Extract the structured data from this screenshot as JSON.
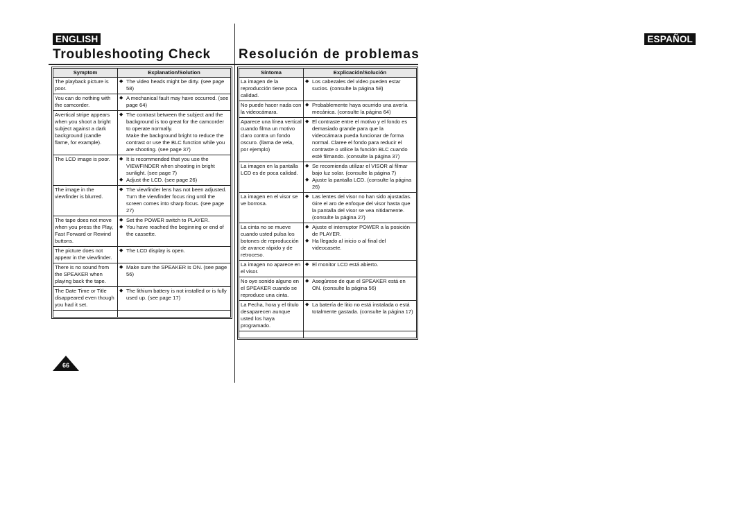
{
  "english": {
    "badge": "ENGLISH",
    "title": "Troubleshooting Check",
    "headers": {
      "symptom": "Symptom",
      "solution": "Explanation/Solution"
    },
    "rows": [
      {
        "symptom": "The playback picture is poor.",
        "solutions": [
          {
            "bullet": true,
            "text": "The video heads might be dirty. (see page 58)"
          }
        ]
      },
      {
        "symptom": "You can do nothing with the camcorder.",
        "solutions": [
          {
            "bullet": true,
            "text": "A mechanical fault may have occurred. (see page 64)"
          }
        ]
      },
      {
        "symptom": "Avertical stripe appears when you shoot a bright subject against a dark background (candle flame, for example).",
        "solutions": [
          {
            "bullet": true,
            "text": "The contrast between the subject and the background is too great for the camcorder to operate normally."
          },
          {
            "bullet": false,
            "text": "Make the background bright to reduce the contrast or use the BLC function while you are shooting. (see page 37)"
          }
        ]
      },
      {
        "symptom": "The LCD image is poor.",
        "solutions": [
          {
            "bullet": true,
            "text": "It is recommended that you use the VIEWFINDER when shooting in bright sunlight. (see page 7)"
          },
          {
            "bullet": true,
            "text": "Adjust the LCD. (see page 26)"
          }
        ]
      },
      {
        "symptom": "The image in the viewfinder is blurred.",
        "solutions": [
          {
            "bullet": true,
            "text": "The viewfinder lens has not been adjusted. Turn the viewfinder focus ring until the screen comes into sharp focus. (see page 27)"
          }
        ]
      },
      {
        "symptom": "The tape does not move when you press the Play, Fast Forward or Rewind buttons.",
        "solutions": [
          {
            "bullet": true,
            "text": "Set the POWER switch to PLAYER."
          },
          {
            "bullet": true,
            "text": "You have reached the beginning or end of the cassette."
          }
        ]
      },
      {
        "symptom": "The picture does not appear in the viewfinder.",
        "solutions": [
          {
            "bullet": true,
            "text": "The LCD display is open."
          }
        ]
      },
      {
        "symptom": "There is no sound from the SPEAKER when playing back the tape.",
        "solutions": [
          {
            "bullet": true,
            "text": "Make sure the SPEAKER is ON. (see page 56)"
          }
        ]
      },
      {
        "symptom": "The Date Time or Title disappeared even though you had it set.",
        "solutions": [
          {
            "bullet": true,
            "text": "The lithium battery is not installed or is fully used up. (see page 17)"
          }
        ]
      }
    ]
  },
  "spanish": {
    "badge": "ESPAÑOL",
    "title": "Resolución de problemas",
    "headers": {
      "symptom": "Síntoma",
      "solution": "Explicación/Solución"
    },
    "rows": [
      {
        "symptom": "La imagen de la reproducción tiene poca calidad.",
        "solutions": [
          {
            "bullet": true,
            "text": "Los cabezales del video pueden estar sucios. (consulte la página 58)"
          }
        ]
      },
      {
        "symptom": "No puede hacer nada con la videocámara.",
        "solutions": [
          {
            "bullet": true,
            "text": "Probablemente haya ocurrido una avería mecánica. (consulte la página 64)"
          }
        ]
      },
      {
        "symptom": "Aparece una línea vertical cuando filma un motivo claro contra un fondo oscuro. (llama de vela, por ejemplo)",
        "solutions": [
          {
            "bullet": true,
            "text": "El contraste entre el motivo y el fondo es demasiado grande para que la videocámara pueda funcionar de forma normal. Claree el fondo para reducir el contraste o utilice la función BLC cuando esté filmando. (consulte la página 37)"
          }
        ]
      },
      {
        "symptom": "La imagen en la pantalla LCD es de poca calidad.",
        "solutions": [
          {
            "bullet": true,
            "text": "Se recomienda utilizar el VISOR al filmar bajo luz solar. (consulte la página 7)"
          },
          {
            "bullet": true,
            "text": "Ajuste la pantalla LCD. (consulte la página 26)"
          }
        ]
      },
      {
        "symptom": "La imagen en el visor se ve borrosa.",
        "solutions": [
          {
            "bullet": true,
            "text": "Las lentes del visor no han sido ajustadas. Gire el aro de enfoque del visor hasta que la pantalla del visor se vea nitidamente. (consulte la página 27)"
          }
        ]
      },
      {
        "symptom": "La cinta no se mueve cuando usted pulsa los botones de reproducción de avance rápido y de retroceso.",
        "solutions": [
          {
            "bullet": true,
            "text": "Ajuste el interruptor POWER a la posición de PLAYER."
          },
          {
            "bullet": true,
            "text": "Ha llegado al inicio o al final del videocasete."
          }
        ]
      },
      {
        "symptom": "La imagen no aparece en el visor.",
        "solutions": [
          {
            "bullet": true,
            "text": "El monitor LCD está abierto."
          }
        ]
      },
      {
        "symptom": "No oye sonido alguno en el SPEAKER cuando se reproduce una cinta.",
        "solutions": [
          {
            "bullet": true,
            "text": "Asegúrese de que el SPEAKER está en ON. (consulte la página 56)"
          }
        ]
      },
      {
        "symptom": "La Fecha, hora y el título desaparecen aunque usted los haya programado.",
        "solutions": [
          {
            "bullet": true,
            "text": "La batería de litio no está instalada o está totalmente gastada. (consulte la página 17)"
          }
        ]
      }
    ]
  },
  "bullet_glyph": "◆",
  "page_number": "66"
}
